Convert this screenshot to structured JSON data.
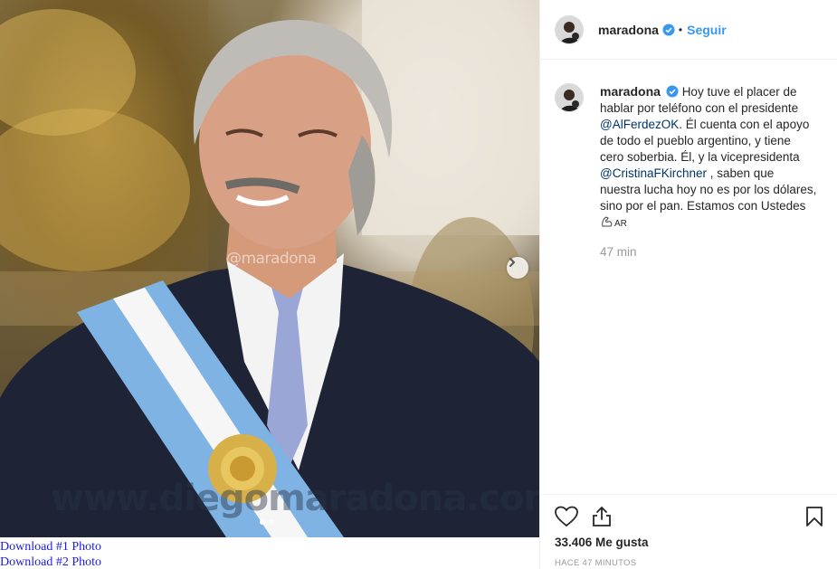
{
  "post": {
    "username": "maradona",
    "follow_label": "Seguir",
    "separator": "•",
    "carousel": {
      "slides": 2,
      "active": 1
    },
    "watermarks": {
      "small": "@maradona",
      "large": "www.diegomaradona.com"
    }
  },
  "downloads": [
    {
      "label": "Download #1 Photo"
    },
    {
      "label": "Download #2 Photo"
    }
  ],
  "caption": {
    "username": "maradona",
    "text_1": "Hoy tuve el placer de hablar por teléfono con el presidente",
    "mention_1": "@AlFerdezOK",
    "text_2": ". Él cuenta con el apoyo de todo el pueblo argentino, y tiene cero soberbia. Él, y la vicepresidenta",
    "mention_2": "@CristinaFKirchner",
    "text_3": " , saben que nuestra lucha hoy no es por los dólares, sino por el pan. Estamos con Ustedes ",
    "emoji_flag": "AR",
    "time": "47 min"
  },
  "stats": {
    "likes": "33.406 Me gusta",
    "ago": "HACE 47 MINUTOS"
  },
  "icons": {
    "like": "heart-icon",
    "share": "share-icon",
    "save": "bookmark-icon",
    "next": "chevron-right-icon",
    "verified": "verified-badge-icon",
    "flex": "flexed-biceps-icon"
  },
  "colors": {
    "link": "#3897f0",
    "mention": "#003569",
    "muted": "#999999",
    "download_link": "#1a1ae6"
  }
}
